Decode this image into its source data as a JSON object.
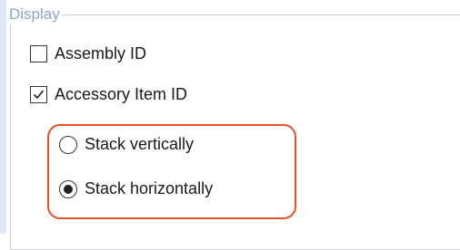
{
  "group": {
    "title": "Display"
  },
  "options": {
    "assembly_id": {
      "label": "Assembly ID",
      "checked": false
    },
    "accessory_item_id": {
      "label": "Accessory Item ID",
      "checked": true
    }
  },
  "layout_radios": {
    "selected": "horizontal",
    "vertical": {
      "label": "Stack vertically"
    },
    "horizontal": {
      "label": "Stack horizontally"
    }
  },
  "annotation": {
    "color": "#e8502a"
  }
}
